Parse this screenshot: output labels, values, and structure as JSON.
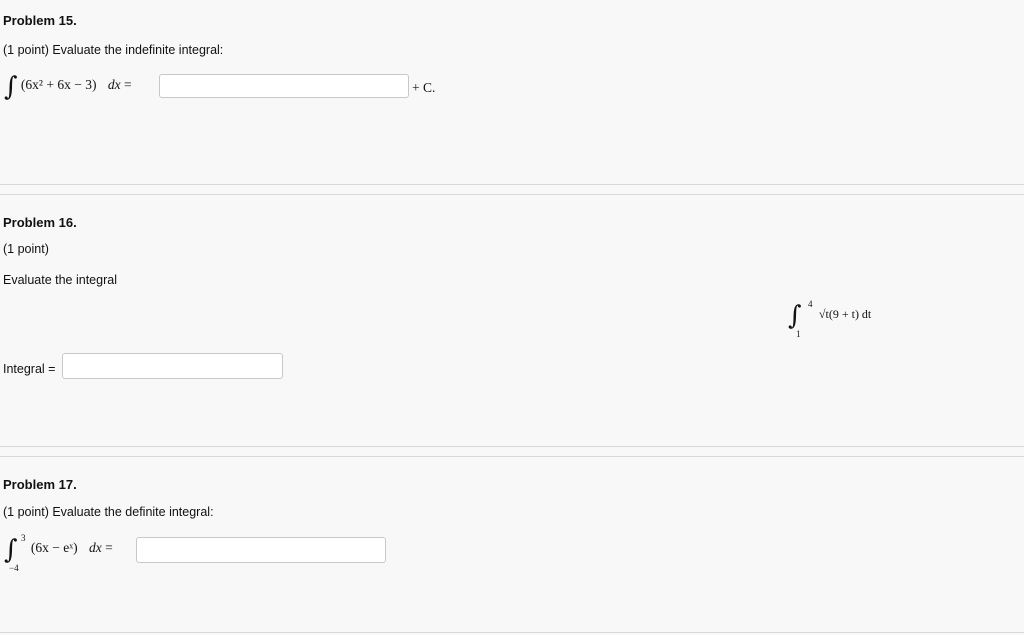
{
  "p15": {
    "title": "Problem 15.",
    "prompt": "(1 point) Evaluate the indefinite integral:",
    "integrand": "(6x² + 6x − 3)",
    "dx": "dx",
    "equals": "=",
    "answer_value": "",
    "plus_c": "+ C."
  },
  "p16": {
    "title": "Problem 16.",
    "points": "(1 point)",
    "prompt": "Evaluate the integral",
    "lower": "1",
    "upper": "4",
    "integrand": "√t(9 + t) dt",
    "answer_label": "Integral =",
    "answer_value": ""
  },
  "p17": {
    "title": "Problem 17.",
    "prompt": "(1 point) Evaluate the definite integral:",
    "lower": "−4",
    "upper": "3",
    "integrand": "(6x − eˣ)",
    "dx": "dx",
    "equals": "=",
    "answer_value": ""
  }
}
